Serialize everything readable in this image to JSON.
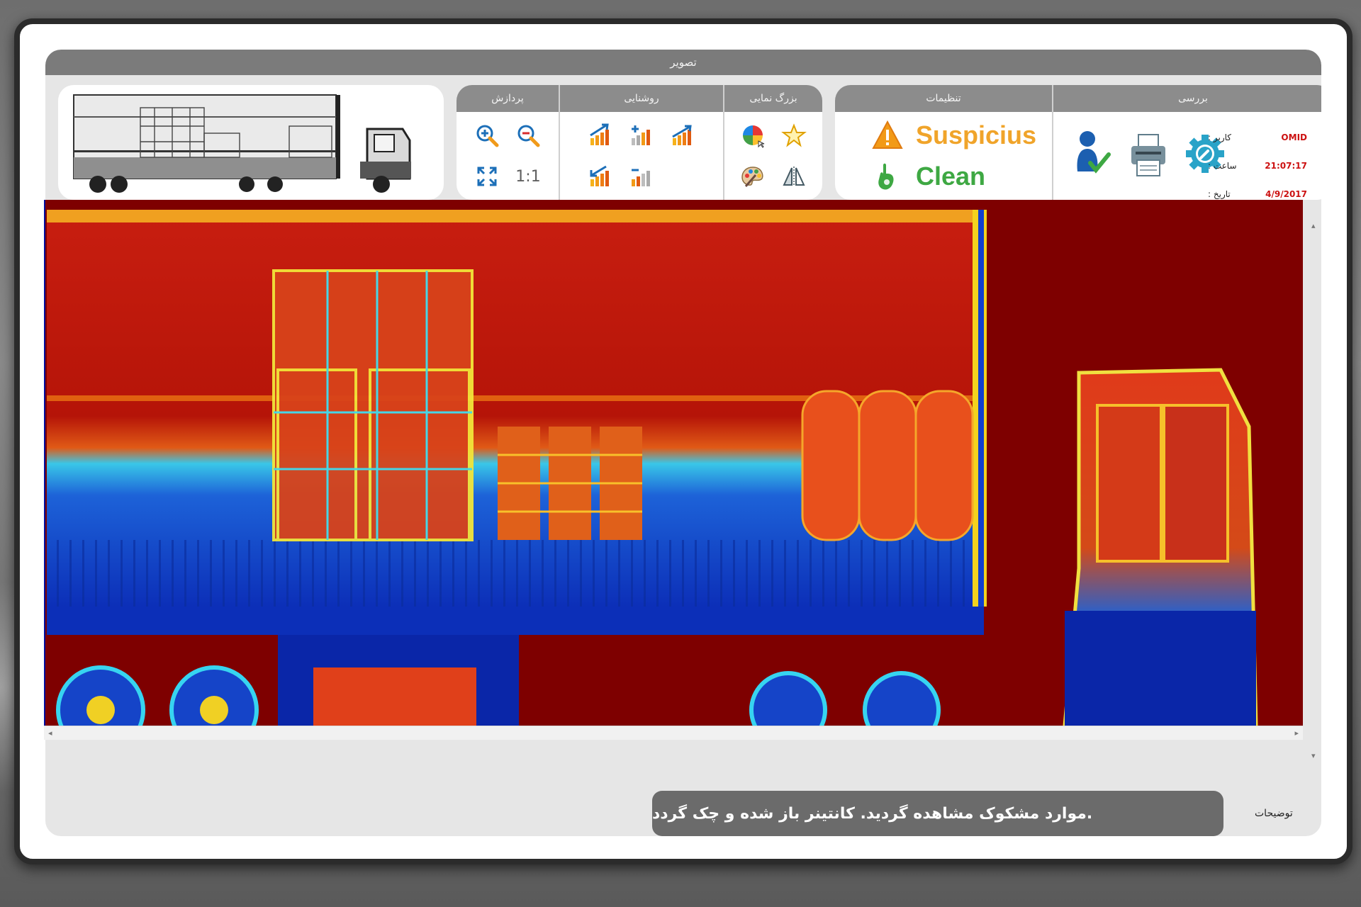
{
  "window": {
    "title": "تصویر"
  },
  "thumbnail": {
    "name": "scan-thumbnail"
  },
  "zoom": {
    "header": "بزرگ نمایی",
    "items": [
      {
        "icon": "zoom-in-icon"
      },
      {
        "icon": "zoom-out-icon"
      },
      {
        "icon": "fit-screen-icon"
      },
      {
        "label": "1:1"
      }
    ]
  },
  "brightness": {
    "header": "روشنایی",
    "items": [
      {
        "icon": "brightness-up-icon"
      },
      {
        "icon": "brightness-plus-icon"
      },
      {
        "icon": "contrast-up-icon"
      },
      {
        "icon": "brightness-down-icon"
      },
      {
        "icon": "brightness-minus-icon"
      }
    ]
  },
  "processing": {
    "header": "پردازش",
    "items": [
      {
        "icon": "color-palette-icon"
      },
      {
        "icon": "star-icon"
      },
      {
        "icon": "paint-palette-icon"
      },
      {
        "icon": "mirror-icon"
      }
    ]
  },
  "review": {
    "header": "بررسی",
    "suspicious_label": "Suspicius",
    "clean_label": "Clean",
    "colors": {
      "suspicious": "#f0a42a",
      "clean": "#3ea843"
    }
  },
  "settings": {
    "header": "تنظیمات",
    "icons": [
      "user-check-icon",
      "printer-icon",
      "settings-gear-icon"
    ]
  },
  "info": {
    "user_label": ": کاربر",
    "user_value": "OMID",
    "time_label": ": ساعت",
    "time_value": "21:07:17",
    "date_label": ": تاریخ",
    "date_value": "4/9/2017"
  },
  "description": {
    "label": "توضیحات",
    "text": ".موارد مشکوک مشاهده گردید. کانتینر باز شده و چک گردد"
  }
}
